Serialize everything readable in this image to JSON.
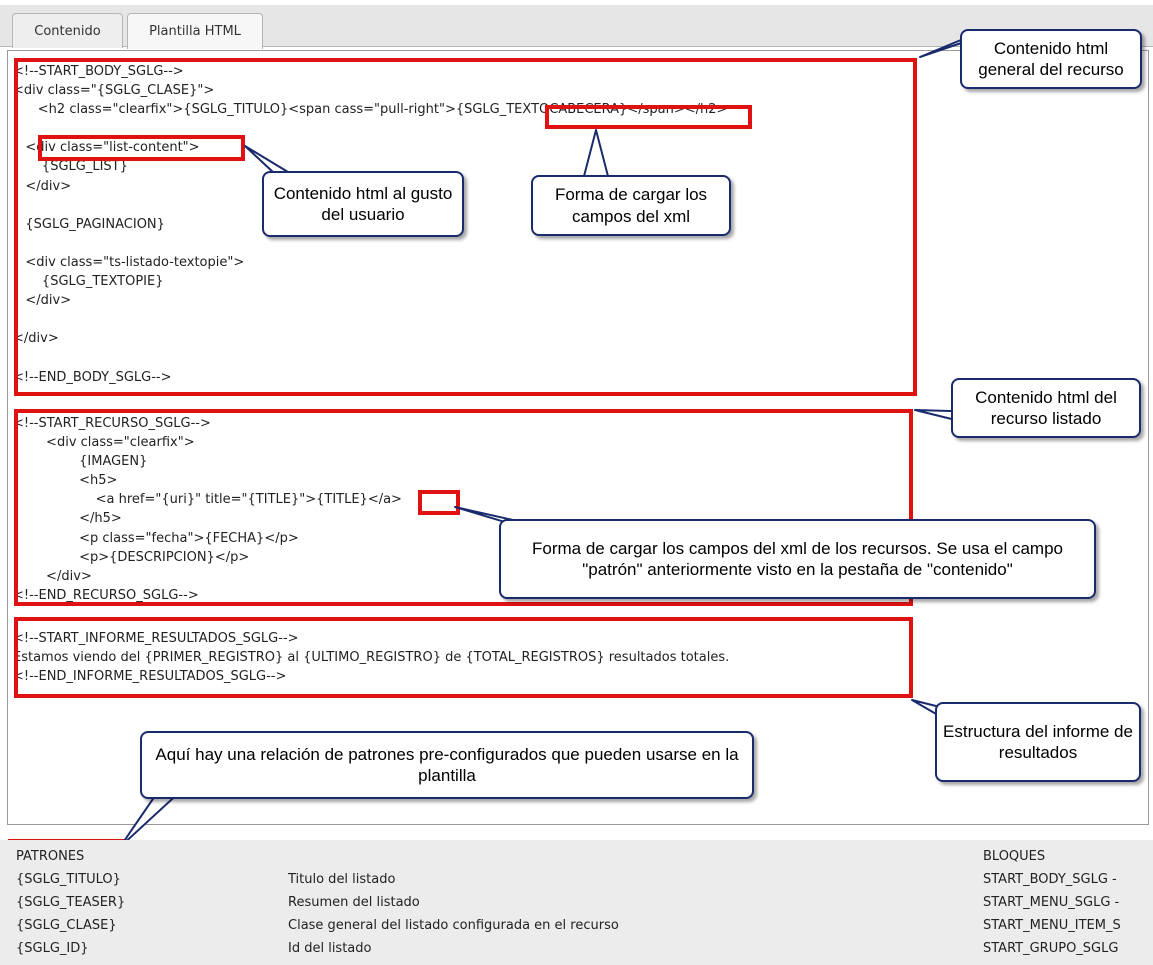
{
  "tabs": [
    {
      "label": "Contenido",
      "active": false
    },
    {
      "label": "Plantilla HTML",
      "active": true
    }
  ],
  "body_block": [
    "<!--START_BODY_SGLG-->",
    "<div class=\"{SGLG_CLASE}\">",
    "      <h2 class=\"clearfix\">{SGLG_TITULO}<span cass=\"pull-right\">{SGLG_TEXTOCABECERA}</span></h2>",
    "",
    "   <div class=\"list-content\">",
    "       {SGLG_LIST}",
    "   </div>",
    "",
    "   {SGLG_PAGINACION}",
    "",
    "   <div class=\"ts-listado-textopie\">",
    "       {SGLG_TEXTOPIE}",
    "   </div>",
    "",
    "</div>",
    "",
    "<!--END_BODY_SGLG-->"
  ],
  "resource_block": [
    "<!--START_RECURSO_SGLG-->",
    "        <div class=\"clearfix\">",
    "                {IMAGEN}",
    "                <h5>",
    "                    <a href=\"{uri}\" title=\"{TITLE}\">{TITLE}</a>",
    "                </h5>",
    "                <p class=\"fecha\">{FECHA}</p>",
    "                <p>{DESCRIPCION}</p>",
    "        </div>",
    "<!--END_RECURSO_SGLG-->"
  ],
  "report_block": [
    "<!--START_INFORME_RESULTADOS_SGLG-->",
    "Estamos viendo del {PRIMER_REGISTRO} al {ULTIMO_REGISTRO} de {TOTAL_REGISTROS} resultados totales.",
    "<!--END_INFORME_RESULTADOS_SGLG-->"
  ],
  "callouts": {
    "general": "Contenido html general del recurso",
    "user_content": "Contenido html al gusto del usuario",
    "load_fields": "Forma de cargar los campos del xml",
    "listed_resource": "Contenido html del recurso listado",
    "load_resource_fields": "Forma de cargar los campos del xml de los recursos. Se usa el campo \"patrón\" anteriormente visto en la pestaña de \"contenido\"",
    "report_structure": "Estructura del informe de resultados",
    "patterns_note": "Aquí hay una relación de patrones pre-configurados que pueden usarse en la plantilla"
  },
  "patterns": {
    "header": "PATRONES",
    "blocks_header": "BLOQUES",
    "rows": [
      {
        "pattern": "{SGLG_TITULO}",
        "description": "Titulo del listado",
        "block": "START_BODY_SGLG -"
      },
      {
        "pattern": "{SGLG_TEASER}",
        "description": "Resumen del listado",
        "block": "START_MENU_SGLG -"
      },
      {
        "pattern": "{SGLG_CLASE}",
        "description": "Clase general del listado configurada en el recurso",
        "block": "START_MENU_ITEM_S"
      },
      {
        "pattern": "{SGLG_ID}",
        "description": "Id del listado",
        "block": "START_GRUPO_SGLG"
      }
    ]
  },
  "colors": {
    "highlight_red": "#e01111",
    "callout_border": "#1a2b6d",
    "tab_bar": "#e6e6e6",
    "patterns_bg": "#ececec"
  }
}
